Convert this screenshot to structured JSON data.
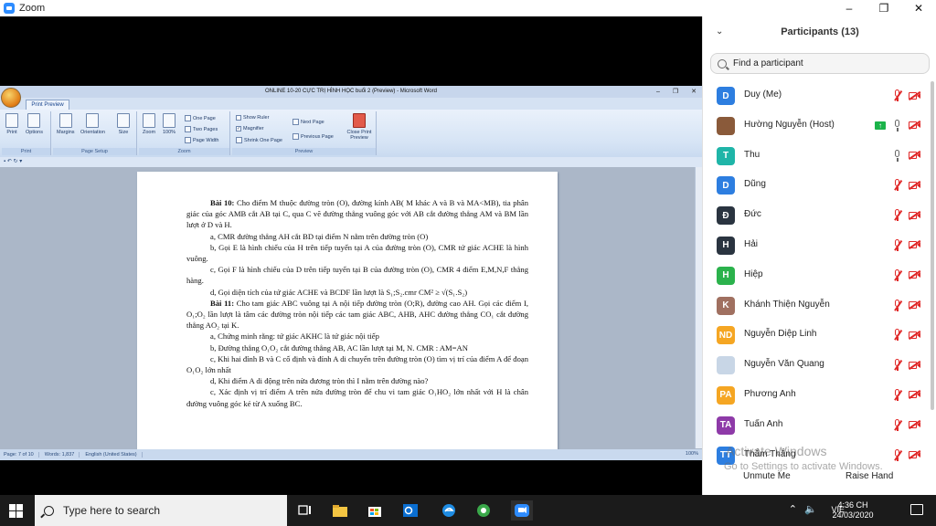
{
  "zoom": {
    "title": "Zoom",
    "window_buttons": [
      "–",
      "❐",
      "✕"
    ]
  },
  "word": {
    "title": "ONLINE 10-20 CỰC TRỊ HÌNH HỌC buổi 2 (Preview) - Microsoft Word",
    "tab": "Print Preview",
    "groups": {
      "print": "Print",
      "page_setup": "Page Setup",
      "zoom": "Zoom",
      "preview": "Preview"
    },
    "buttons": {
      "print": "Print",
      "options": "Options",
      "margins": "Margins",
      "orientation": "Orientation",
      "size": "Size",
      "zoom": "Zoom",
      "zoom100": "100%",
      "one_page": "One Page",
      "two_pages": "Two Pages",
      "page_width": "Page Width",
      "show_ruler": "Show Ruler",
      "magnifier": "Magnifier",
      "shrink_one_page": "Shrink One Page",
      "next_page": "Next Page",
      "previous_page": "Previous Page",
      "close_print_preview": "Close Print Preview"
    },
    "status": {
      "page": "Page: 7 of 10",
      "words": "Words: 1,837",
      "language": "English (United States)",
      "zoom": "100%"
    },
    "doc": {
      "p1_label": "Bài 10:",
      "p1": " Cho điểm M thuộc đường tròn (O), đường kính AB( M khác A và B và MA<MB), tia phân giác của góc AMB cắt AB tại C, qua C vẽ đường thẳng vuông góc với AB cắt đường thẳng AM và BM lần lượt ở D và H.",
      "p2": "a, CMR đường thẳng AH cắt BD tại điểm N nằm trên đường tròn (O)",
      "p3": "b, Gọi E là hình chiếu của H trên tiếp tuyến tại A của đường tròn (O), CMR tứ giác ACHE là hình vuông.",
      "p4": "c, Gọi F là hình chiếu của D trên tiếp tuyến tại B của đường tròn (O), CMR 4 điểm E,M,N,F thẳng hàng.",
      "p5": "d, Gọi diện tích của tứ giác ACHE và BCDF lần lượt là S₁;S₂.cmr   CM² ≥ √(S₁.S₂)",
      "p6_label": "Bài 11:",
      "p6": " Cho tam giác ABC vuông tại A nội tiếp đường tròn (O;R), đường cao AH. Gọi các điểm  I, O₁;O₂ lần lượt là tâm các đường tròn nội tiếp các tam giác ABC, AHB, AHC đường thẳng  CO₁  cắt đường thẳng  AO₂ tại K.",
      "p7": "a, Chứng minh rằng: tứ giác AKHC là tứ giác nội tiếp",
      "p8": "b, Đường thẳng O₁O₂ cắt đường thẳng AB, AC lần lượt tại M, N. CMR : AM=AN",
      "p9": "c, Khi hai đỉnh B và C cố định và đỉnh A di chuyển trên đường tròn (O) tìm vị trí của điểm A để đoạn O₁O₂ lớn nhất",
      "p10": "d, Khi điểm A di động trên nửa đương tròn  thì I nằm trên đường nào?",
      "p11": "c, Xác định vị trí điểm A trên nửa đường tròn để chu vi tam giác O₁HO₂ lớn nhất với H là chân đường vuông góc kẻ từ A xuống BC."
    }
  },
  "panel": {
    "title": "Participants (13)",
    "search_placeholder": "Find a participant",
    "unmute": "Unmute Me",
    "raise_hand": "Raise Hand",
    "participants": [
      {
        "initials": "D",
        "name": "Duy (Me)",
        "color": "#2d7ee0",
        "mic": "muted"
      },
      {
        "initials": "",
        "name": "Hường Nguyễn (Host)",
        "color": "#8a5a3a",
        "mic": "on",
        "share": true
      },
      {
        "initials": "T",
        "name": "Thu",
        "color": "#1fb5a8",
        "mic": "on"
      },
      {
        "initials": "D",
        "name": "Dũng",
        "color": "#2d7ee0",
        "mic": "muted"
      },
      {
        "initials": "Đ",
        "name": "Đức",
        "color": "#2a3440",
        "mic": "muted"
      },
      {
        "initials": "H",
        "name": "Hải",
        "color": "#2a3440",
        "mic": "muted"
      },
      {
        "initials": "H",
        "name": "Hiệp",
        "color": "#2bb24c",
        "mic": "muted"
      },
      {
        "initials": "K",
        "name": "Khánh Thiện Nguyễn",
        "color": "#a07060",
        "mic": "muted"
      },
      {
        "initials": "ND",
        "name": "Nguyễn Diệp Linh",
        "color": "#f5a623",
        "mic": "muted"
      },
      {
        "initials": "",
        "name": "Nguyễn Văn Quang",
        "color": "#c8d6e6",
        "mic": "muted"
      },
      {
        "initials": "PA",
        "name": "Phương Anh",
        "color": "#f5a623",
        "mic": "muted"
      },
      {
        "initials": "TA",
        "name": "Tuấn Anh",
        "color": "#8e3aa8",
        "mic": "muted"
      },
      {
        "initials": "TT",
        "name": "Thắm Thắng",
        "color": "#2d7ee0",
        "mic": "muted"
      }
    ]
  },
  "watermark": {
    "line1": "Activate Windows",
    "line2": "Go to Settings to activate Windows."
  },
  "taskbar": {
    "search": "Type here to search",
    "lang": "VIE",
    "time": "4:36 CH",
    "date": "24/03/2020"
  }
}
